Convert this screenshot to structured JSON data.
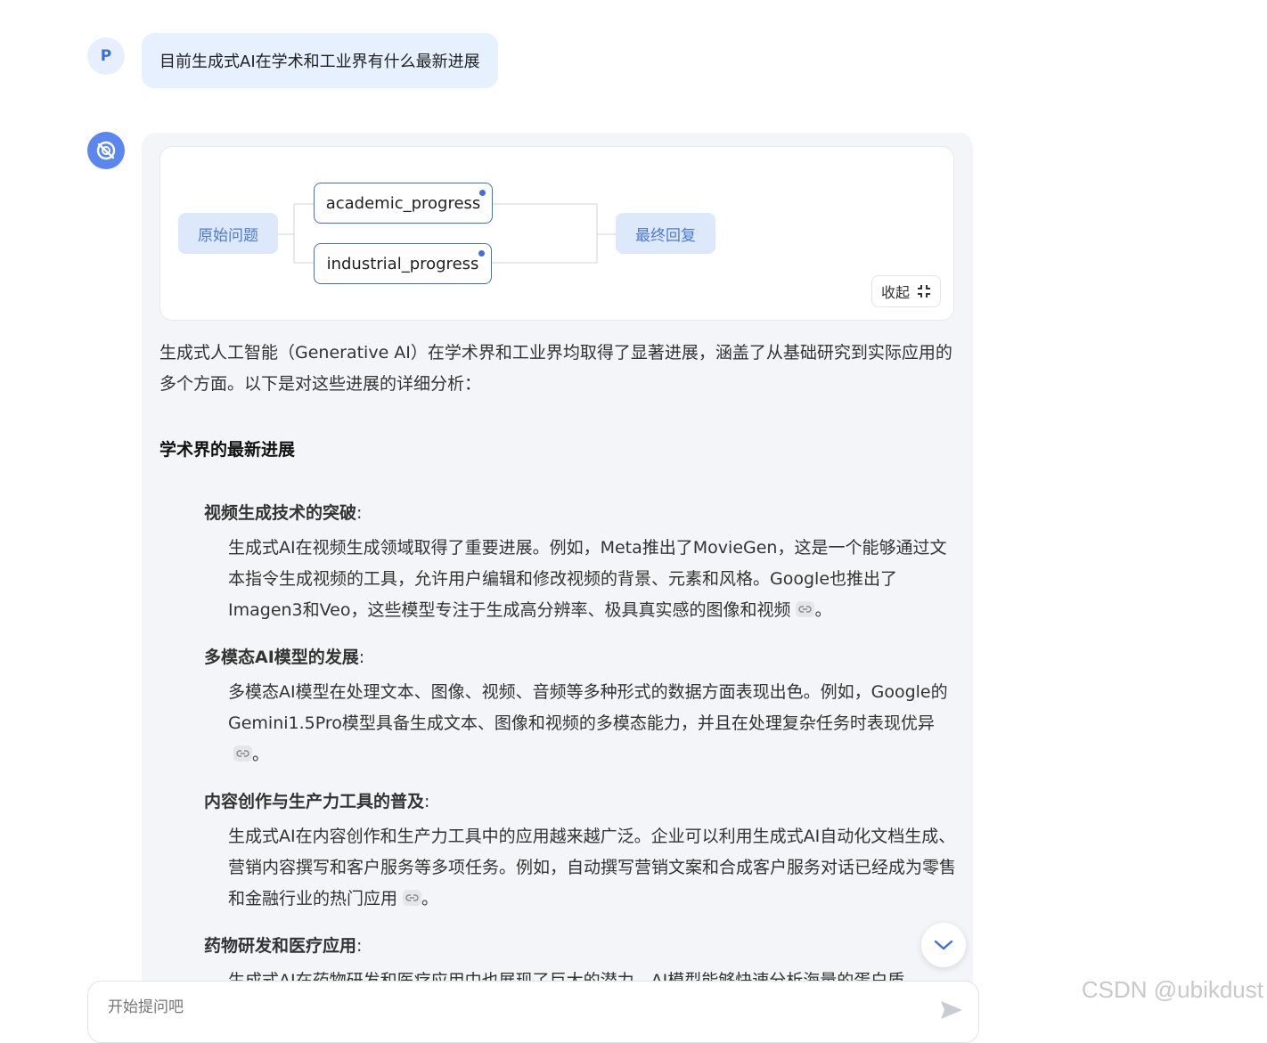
{
  "user": {
    "avatar_letter": "P",
    "message": "目前生成式AI在学术和工业界有什么最新进展"
  },
  "flow": {
    "start_label": "原始问题",
    "steps": [
      "academic_progress",
      "industrial_progress"
    ],
    "end_label": "最终回复",
    "collapse_label": "收起",
    "accent_color": "#3f6fd8"
  },
  "answer": {
    "intro": "生成式人工智能（Generative AI）在学术界和工业界均取得了显著进展，涵盖了从基础研究到实际应用的多个方面。以下是对这些进展的详细分析：",
    "section_title": "学术界的最新进展",
    "items": [
      {
        "title": "视频生成技术的突破",
        "body": "生成式AI在视频生成领域取得了重要进展。例如，Meta推出了MovieGen，这是一个能够通过文本指令生成视频的工具，允许用户编辑和修改视频的背景、元素和风格。Google也推出了Imagen3和Veo，这些模型专注于生成高分辨率、极具真实感的图像和视频"
      },
      {
        "title": "多模态AI模型的发展",
        "body": "多模态AI模型在处理文本、图像、视频、音频等多种形式的数据方面表现出色。例如，Google的Gemini1.5Pro模型具备生成文本、图像和视频的多模态能力，并且在处理复杂任务时表现优异"
      },
      {
        "title": "内容创作与生产力工具的普及",
        "body": "生成式AI在内容创作和生产力工具中的应用越来越广泛。企业可以利用生成式AI自动化文档生成、营销内容撰写和客户服务等多项任务。例如，自动撰写营销文案和合成客户服务对话已经成为零售和金融行业的热门应用"
      },
      {
        "title": "药物研发和医疗应用",
        "body": "生成式AI在药物研发和医疗应用中也展现了巨大的潜力。AI模型能够快速分析海量的蛋白质"
      }
    ],
    "title_suffix": ":",
    "body_suffix": "。"
  },
  "input": {
    "placeholder": "开始提问吧"
  },
  "watermark": "CSDN @ubikdust"
}
